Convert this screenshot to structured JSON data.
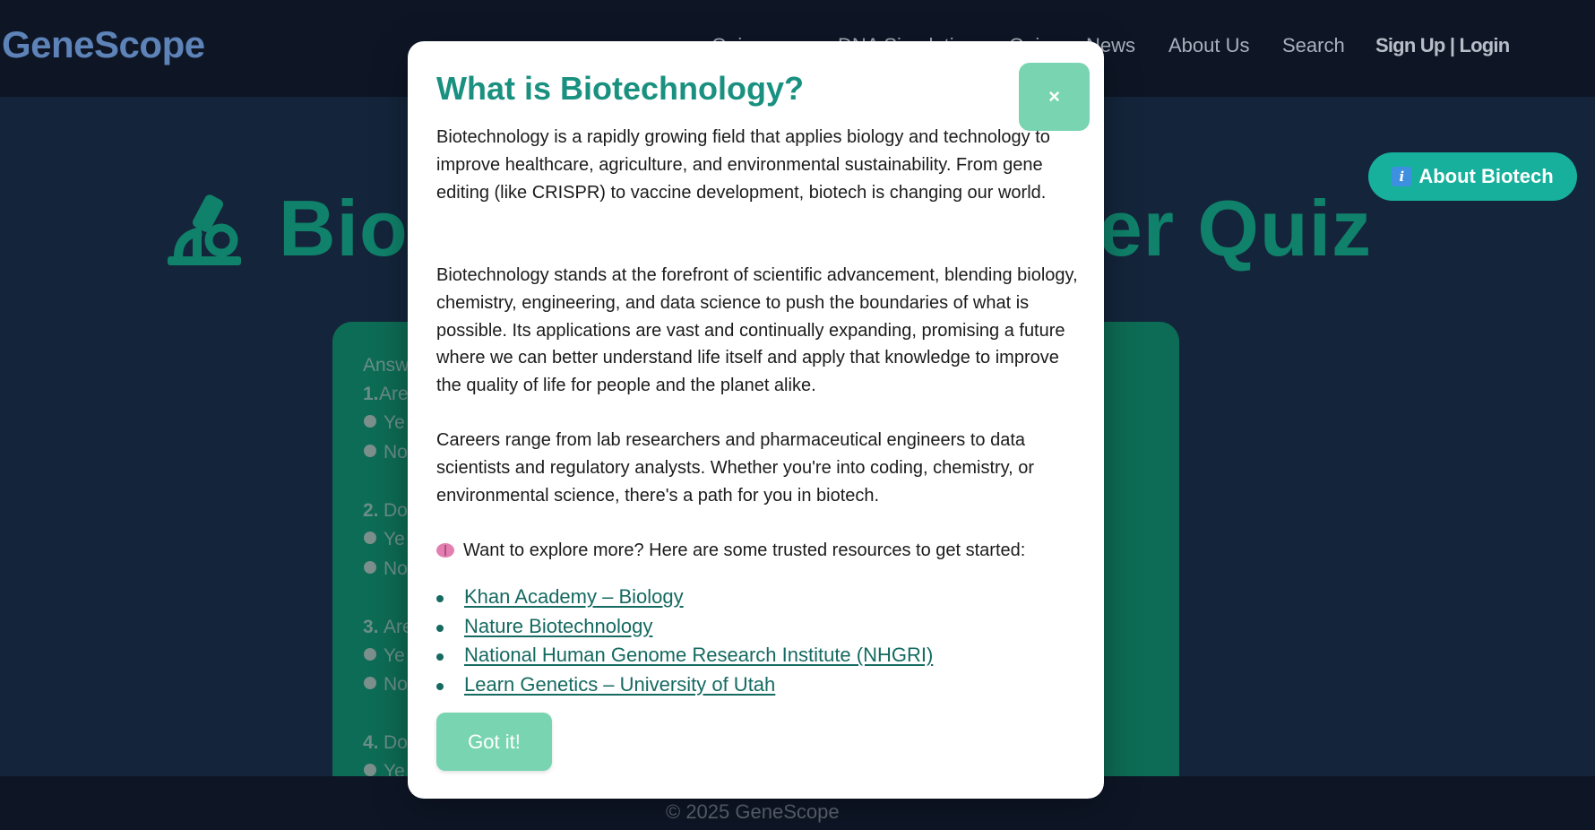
{
  "brand": "GeneScope",
  "nav": {
    "items": [
      "Quiz",
      "DNA Simulation",
      "Quiz",
      "News",
      "About Us",
      "Search"
    ],
    "account": "Sign Up | Login"
  },
  "about_button": {
    "icon": "info-icon",
    "label": "About Biotech"
  },
  "hero": {
    "icon": "microscope-icon",
    "title_left": "Bio",
    "title_right": "er Quiz"
  },
  "quiz": {
    "intro": "Answ",
    "questions": [
      {
        "number": "1.",
        "text": "Are",
        "options": [
          "Ye",
          "No"
        ]
      },
      {
        "number": "2.",
        "text": "Do",
        "options": [
          "Ye",
          "No"
        ]
      },
      {
        "number": "3.",
        "text": "Are",
        "options": [
          "Ye",
          "No"
        ]
      },
      {
        "number": "4.",
        "text": "Do",
        "options": [
          "Ye"
        ]
      }
    ]
  },
  "footer": {
    "text": "© 2025 GeneScope"
  },
  "modal": {
    "title": "What is Biotechnology?",
    "close_label": "×",
    "paragraphs": [
      "Biotechnology is a rapidly growing field that applies biology and technology to improve healthcare, agriculture, and environmental sustainability. From gene editing (like CRISPR) to vaccine development, biotech is changing our world.",
      "Biotechnology stands at the forefront of scientific advancement, blending biology, chemistry, engineering, and data science to push the boundaries of what is possible. Its applications are vast and continually expanding, promising a future where we can better understand life itself and apply that knowledge to improve the quality of life for people and the planet alike.",
      "Careers range from lab researchers and pharmaceutical engineers to data scientists and regulatory analysts. Whether you're into coding, chemistry, or environmental science, there's a path for you in biotech."
    ],
    "resources_icon": "brain-icon",
    "resources_intro": "Want to explore more? Here are some trusted resources to get started:",
    "resources": [
      "Khan Academy – Biology",
      "Nature Biotechnology",
      "National Human Genome Research Institute (NHGRI)",
      "Learn Genetics – University of Utah"
    ],
    "confirm_label": "Got it!"
  },
  "colors": {
    "page_bg": "#14253b",
    "nav_bg": "#0e1626",
    "accent": "#17b09c",
    "modal_title": "#1a9180",
    "button_mint": "#79d5b1",
    "link": "#156a61",
    "quiz_card": "#0d6c55"
  }
}
